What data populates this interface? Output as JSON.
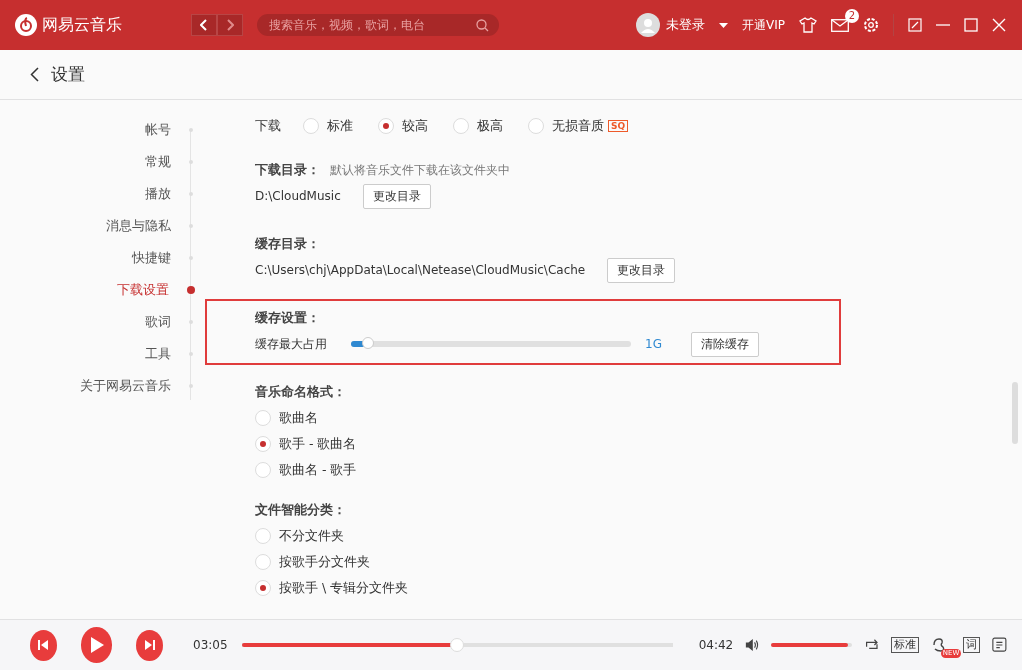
{
  "app": {
    "name": "网易云音乐"
  },
  "search": {
    "placeholder": "搜索音乐，视频，歌词，电台"
  },
  "user": {
    "name": "未登录",
    "vip": "开通VIP",
    "messages": "2"
  },
  "page": {
    "title": "设置"
  },
  "sidebar": {
    "items": [
      {
        "label": "帐号",
        "selected": false
      },
      {
        "label": "常规",
        "selected": false
      },
      {
        "label": "播放",
        "selected": false
      },
      {
        "label": "消息与隐私",
        "selected": false
      },
      {
        "label": "快捷键",
        "selected": false
      },
      {
        "label": "下载设置",
        "selected": true
      },
      {
        "label": "歌词",
        "selected": false
      },
      {
        "label": "工具",
        "selected": false
      },
      {
        "label": "关于网易云音乐",
        "selected": false
      }
    ]
  },
  "quality": {
    "label": "下载",
    "options": [
      {
        "label": "标准",
        "selected": false
      },
      {
        "label": "较高",
        "selected": true
      },
      {
        "label": "极高",
        "selected": false
      },
      {
        "label": "无损音质",
        "selected": false,
        "badge": "SQ"
      }
    ]
  },
  "download_dir": {
    "title": "下载目录：",
    "hint": "默认将音乐文件下载在该文件夹中",
    "path": "D:\\CloudMusic",
    "button": "更改目录"
  },
  "cache_dir": {
    "title": "缓存目录：",
    "path": "C:\\Users\\chj\\AppData\\Local\\Netease\\CloudMusic\\Cache",
    "button": "更改目录"
  },
  "cache": {
    "title": "缓存设置：",
    "label": "缓存最大占用",
    "level": 0.05,
    "reading": "1G",
    "button": "清除缓存"
  },
  "naming": {
    "title": "音乐命名格式：",
    "options": [
      {
        "label": "歌曲名",
        "selected": false
      },
      {
        "label": "歌手 - 歌曲名",
        "selected": true
      },
      {
        "label": "歌曲名 - 歌手",
        "selected": false
      }
    ]
  },
  "sorting": {
    "title": "文件智能分类：",
    "options": [
      {
        "label": "不分文件夹",
        "selected": false
      },
      {
        "label": "按歌手分文件夹",
        "selected": false
      },
      {
        "label": "按歌手 \\ 专辑分文件夹",
        "selected": true
      }
    ]
  },
  "player": {
    "elapsed": "03:05",
    "total": "04:42",
    "level": 0.5,
    "volume": {
      "level": 0.95
    },
    "quality": "标准",
    "lyrics": "词",
    "new_badge": "NEW"
  }
}
